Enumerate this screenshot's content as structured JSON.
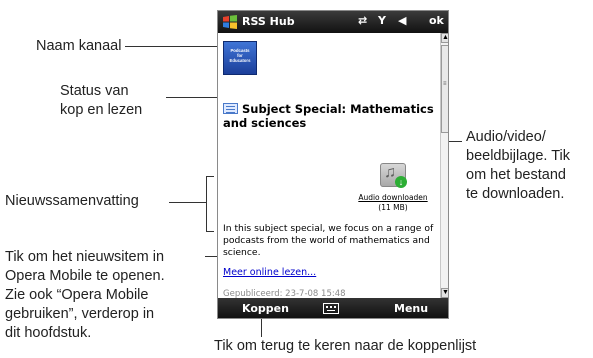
{
  "annotations": {
    "channel_name": "Naam kanaal",
    "status_line1": "Status van",
    "status_line2": "kop en lezen",
    "attachment_line1": "Audio/video/",
    "attachment_line2": "beeldbijlage. Tik",
    "attachment_line3": "om het bestand",
    "attachment_line4": "te downloaden.",
    "summary": "Nieuwssamenvatting",
    "open_line1": "Tik om het nieuwsitem in",
    "open_line2": "Opera Mobile te openen.",
    "open_line3": "Zie ook “Opera Mobile",
    "open_line4": "gebruiken”, verderop in",
    "open_line5": "dit hoofdstuk.",
    "back": "Tik om terug te keren naar de koppenlijst"
  },
  "phone": {
    "title": "RSS Hub",
    "status_icons": {
      "sync": "⇄",
      "signal": "Y",
      "volume": "◀",
      "ok": "ok"
    },
    "feed_logo_text": [
      "Podcasts",
      "for",
      "Educators"
    ],
    "headline": "Subject Special: Mathematics and sciences",
    "attachment": {
      "link": "Audio downloaden",
      "size": "(11 MB)",
      "icon": "audio-attachment-icon"
    },
    "summary": "In this subject special, we focus on a range of podcasts from the world of mathematics and science.",
    "read_more": "Meer online lezen...",
    "published": "Gepubliceerd: 23-7-08 15:48",
    "softkeys": {
      "left": "Koppen",
      "right": "Menu"
    }
  },
  "colors": {
    "bar": "#111111",
    "link": "#0000cc",
    "logo": "#2a56c0",
    "download": "#2cae34"
  }
}
